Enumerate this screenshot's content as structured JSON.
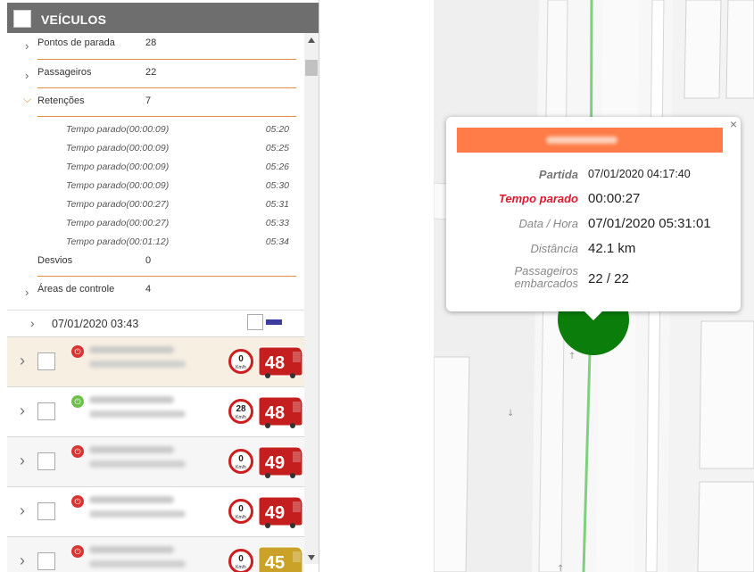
{
  "panel": {
    "title": "VEÍCULOS",
    "summary": [
      {
        "label": "Pontos de parada",
        "value": "28"
      },
      {
        "label": "Passageiros",
        "value": "22"
      },
      {
        "label": "Retenções",
        "value": "7"
      }
    ],
    "retentions": [
      {
        "label": "Tempo parado(00:00:09)",
        "time": "05:20"
      },
      {
        "label": "Tempo parado(00:00:09)",
        "time": "05:25"
      },
      {
        "label": "Tempo parado(00:00:09)",
        "time": "05:26"
      },
      {
        "label": "Tempo parado(00:00:09)",
        "time": "05:30"
      },
      {
        "label": "Tempo parado(00:00:27)",
        "time": "05:31"
      },
      {
        "label": "Tempo parado(00:00:27)",
        "time": "05:33"
      },
      {
        "label": "Tempo parado(00:01:12)",
        "time": "05:34"
      }
    ],
    "desvios": {
      "label": "Desvios",
      "value": "0"
    },
    "areas": {
      "label": "Áreas de controle",
      "value": "4"
    },
    "date_row": "07/01/2020 03:43",
    "route_color": "#3c3c9c"
  },
  "vehicles": [
    {
      "speed": "0",
      "unit": "Km/h",
      "line": "48",
      "status": "off",
      "bus_color": "#c41e1e",
      "highlight": true
    },
    {
      "speed": "28",
      "unit": "Km/h",
      "line": "48",
      "status": "on",
      "bus_color": "#c41e1e",
      "highlight": false
    },
    {
      "speed": "0",
      "unit": "Km/h",
      "line": "49",
      "status": "off",
      "bus_color": "#c41e1e",
      "highlight": false
    },
    {
      "speed": "0",
      "unit": "Km/h",
      "line": "49",
      "status": "off",
      "bus_color": "#c41e1e",
      "highlight": false
    },
    {
      "speed": "0",
      "unit": "Km/h",
      "line": "45",
      "status": "off",
      "bus_color": "#c9a227",
      "highlight": false
    }
  ],
  "popup": {
    "close": "×",
    "accent": "#ff7b47",
    "rows": [
      {
        "label": "Partida",
        "value": "07/01/2020 04:17:40"
      },
      {
        "label": "Tempo parado",
        "value": "00:00:27"
      },
      {
        "label": "Data / Hora",
        "value": "07/01/2020 05:31:01"
      },
      {
        "label": "Distância",
        "value": "42.1 km"
      },
      {
        "label": "Passageiros\nembarcados",
        "value": "22 / 22"
      }
    ]
  },
  "map": {
    "route_color": "#7fcf7f",
    "marker_color": "#0a7d0a"
  }
}
